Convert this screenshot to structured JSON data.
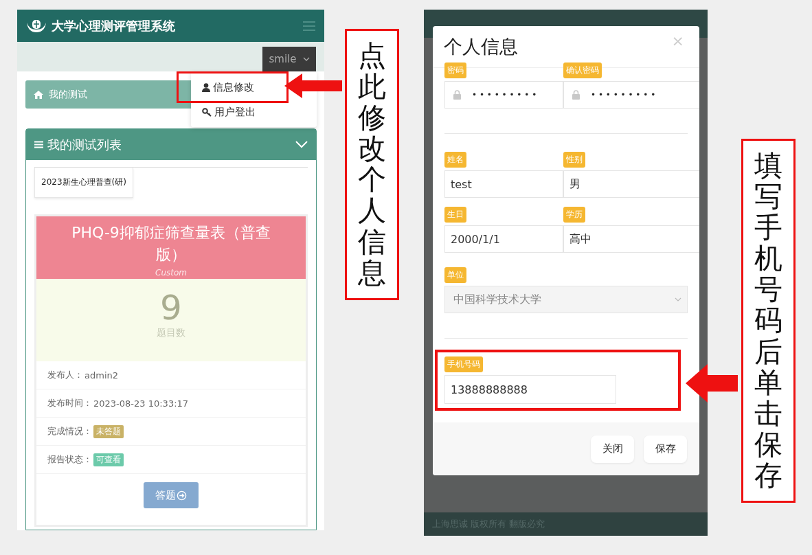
{
  "left_screen": {
    "brand": "大学心理测评管理系统",
    "user_menu": "smile",
    "dropdown": [
      {
        "kind": "edit",
        "label": "信息修改",
        "highlighted": true
      },
      {
        "kind": "logout",
        "label": "用户登出",
        "highlighted": false
      }
    ],
    "breadcrumb": "我的测试",
    "panel_title": "我的测试列表",
    "tabs": [
      {
        "label": "2023新生心理普查(研)",
        "selected": true
      }
    ],
    "card": {
      "title": "PHQ-9抑郁症筛查量表（普查版）",
      "subtitle": "Custom",
      "count": "9",
      "count_label": "题目数",
      "rows": [
        {
          "kind": "text",
          "label": "发布人：",
          "value": "admin2"
        },
        {
          "kind": "text",
          "label": "发布时间：",
          "value": "2023-08-23 10:33:17"
        },
        {
          "kind": "badge",
          "label": "完成情况：",
          "value": "未答题",
          "color": "#c9b266"
        },
        {
          "kind": "badge",
          "label": "报告状态：",
          "value": "可查看",
          "color": "#6ccaaa"
        }
      ],
      "button": "答题"
    }
  },
  "right_screen": {
    "modal_title": "个人信息",
    "close": "×",
    "fields": [
      {
        "kind": "password",
        "label": "密码",
        "value": "• • • • • • • • •",
        "highlighted": false
      },
      {
        "kind": "password",
        "label": "确认密码",
        "value": "• • • • • • • • •",
        "highlighted": false
      },
      {
        "kind": "divider"
      },
      {
        "kind": "text",
        "label": "姓名",
        "value": "test",
        "highlighted": false
      },
      {
        "kind": "text",
        "label": "性别",
        "value": "男",
        "highlighted": false
      },
      {
        "kind": "text",
        "label": "生日",
        "value": "2000/1/1",
        "highlighted": false
      },
      {
        "kind": "text",
        "label": "学历",
        "value": "高中",
        "highlighted": false
      },
      {
        "kind": "select",
        "label": "单位",
        "value": "中国科学技术大学",
        "highlighted": false
      },
      {
        "kind": "divider"
      },
      {
        "kind": "phone",
        "label": "手机号码",
        "value": "13888888888",
        "highlighted": true
      }
    ],
    "buttons": [
      "关闭",
      "保存"
    ],
    "footer": "上海思诚 版权所有 翻版必究"
  },
  "callouts": [
    {
      "text": "点此修改个人信息"
    },
    {
      "text": "填写手机号码后单击保存"
    }
  ]
}
